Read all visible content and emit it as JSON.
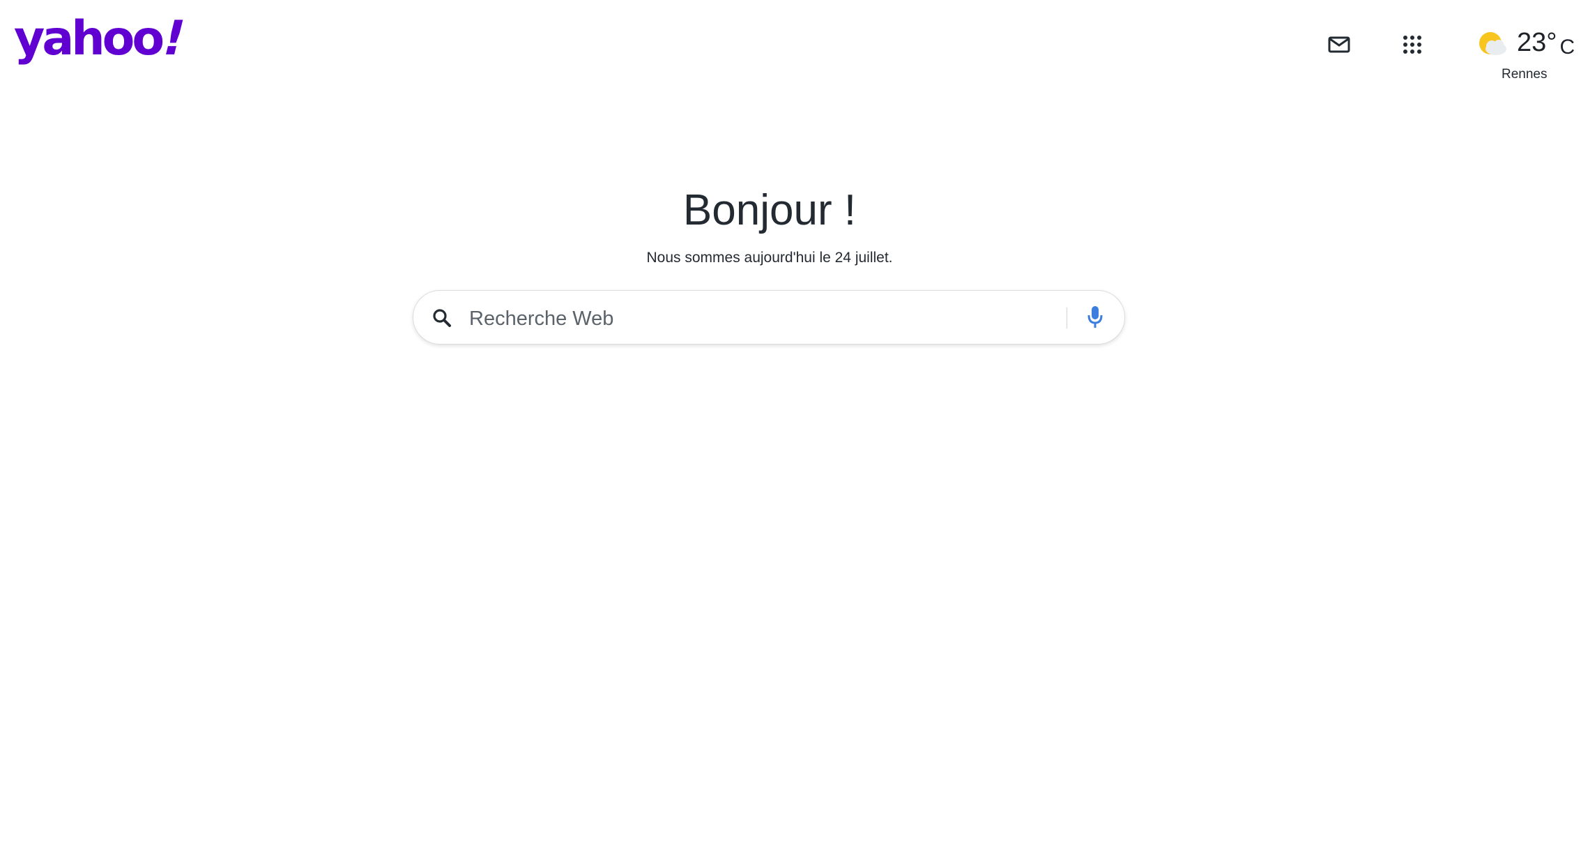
{
  "header": {
    "logo_main": "yahoo",
    "logo_bang": "!",
    "mail_icon": "mail-icon",
    "apps_icon": "apps-grid-icon"
  },
  "weather": {
    "icon": "partly-cloudy-icon",
    "temperature": "23°",
    "unit": "C",
    "city": "Rennes"
  },
  "main": {
    "greeting": "Bonjour !",
    "date_line": "Nous sommes aujourd'hui le 24 juillet."
  },
  "search": {
    "placeholder": "Recherche Web",
    "value": "",
    "search_icon": "search-icon",
    "mic_icon": "microphone-icon"
  },
  "colors": {
    "brand": "#6001d2",
    "text": "#232a31",
    "mic": "#3c7ee0",
    "sun": "#f7c51e"
  }
}
